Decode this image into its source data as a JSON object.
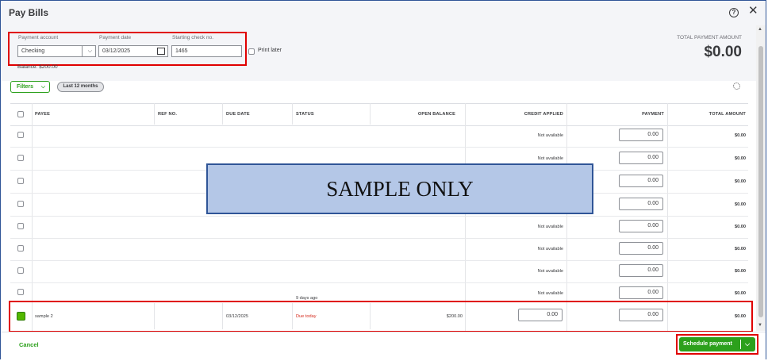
{
  "window": {
    "title": "Pay Bills",
    "help_icon": "help-icon",
    "close_icon": "close-icon",
    "close_glyph": "✕"
  },
  "payment": {
    "account_label": "Payment account",
    "account_value": "Checking",
    "date_label": "Payment date",
    "date_value": "03/12/2025",
    "check_label": "Starting check no.",
    "check_value": "1465",
    "print_later_label": "Print later",
    "balance": "Balance: $200.00"
  },
  "total": {
    "label": "TOTAL PAYMENT AMOUNT",
    "value": "$0.00"
  },
  "filters": {
    "button_label": "Filters",
    "pill_label": "Last 12 months"
  },
  "table": {
    "columns": [
      "PAYEE",
      "REF NO.",
      "DUE DATE",
      "STATUS",
      "OPEN BALANCE",
      "CREDIT APPLIED",
      "PAYMENT",
      "TOTAL AMOUNT"
    ],
    "rows": [
      {
        "credit": "Not available",
        "payment": "0.00",
        "total": "$0.00"
      },
      {
        "credit": "Not available",
        "payment": "0.00",
        "total": "$0.00"
      },
      {
        "credit": "",
        "payment": "0.00",
        "total": "$0.00"
      },
      {
        "credit": "",
        "payment": "0.00",
        "total": "$0.00"
      },
      {
        "credit": "Not available",
        "payment": "0.00",
        "total": "$0.00"
      },
      {
        "credit": "Not available",
        "payment": "0.00",
        "total": "$0.00"
      },
      {
        "credit": "Not available",
        "payment": "0.00",
        "total": "$0.00"
      },
      {
        "credit": "Not available",
        "payment": "0.00",
        "total": "$0.00",
        "status": "9 days ago"
      }
    ],
    "selected_row": {
      "payee": "sample 2",
      "due_date": "03/12/2025",
      "status": "Due today",
      "open_balance": "$200.00",
      "credit": "0.00",
      "payment": "0.00",
      "total": "$0.00"
    }
  },
  "overlay": {
    "text": "SAMPLE ONLY"
  },
  "footer": {
    "cancel_label": "Cancel",
    "schedule_label": "Schedule payment"
  },
  "colors": {
    "accent": "#2ca01c",
    "highlight": "#e00000",
    "overlay_fill": "#b4c7e7",
    "overlay_border": "#2f5597",
    "status_due": "#d52b1e"
  }
}
